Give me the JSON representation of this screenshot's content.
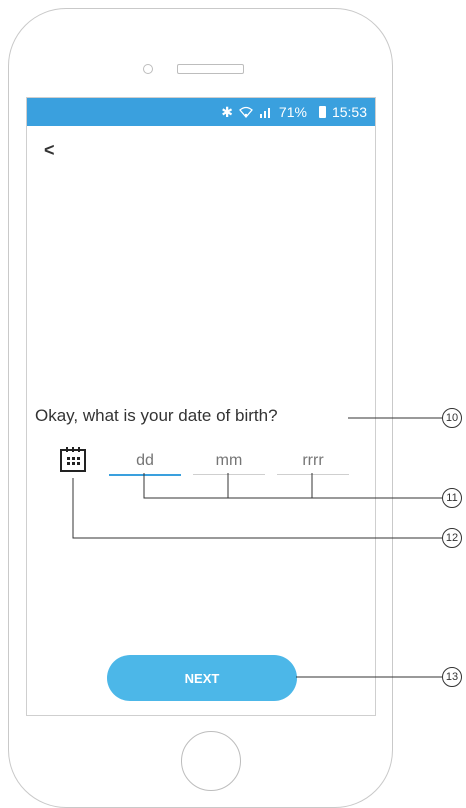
{
  "status_bar": {
    "bluetooth_icon": "bluetooth-icon",
    "wifi_icon": "wifi-icon",
    "signal_icon": "signal-icon",
    "battery_percent": "71%",
    "time": "15:53"
  },
  "nav": {
    "back_label": "<"
  },
  "question": "Okay, what is your date of birth?",
  "date_fields": {
    "day_placeholder": "dd",
    "month_placeholder": "mm",
    "year_placeholder": "rrrr"
  },
  "next_label": "NEXT",
  "annotations": {
    "a10": "10",
    "a11": "11",
    "a12": "12",
    "a13": "13"
  },
  "colors": {
    "accent": "#3aa0de",
    "button": "#4cb7e8"
  }
}
